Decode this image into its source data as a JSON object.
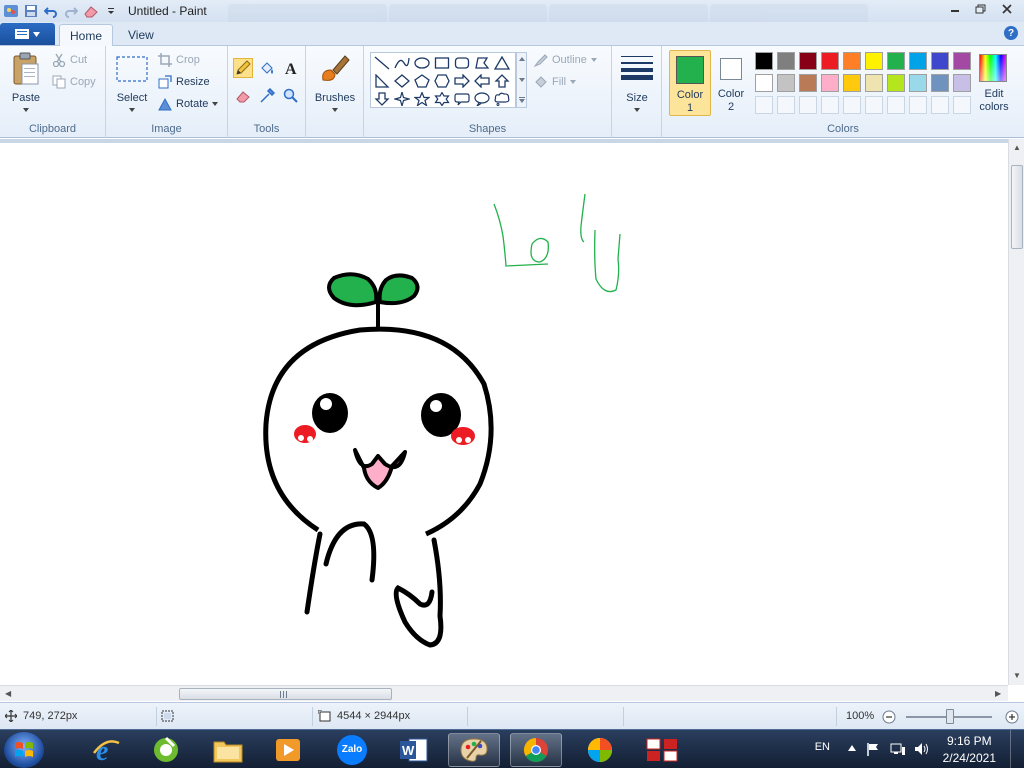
{
  "window": {
    "title": "Untitled - Paint"
  },
  "ribbon_tabs": {
    "home": "Home",
    "view": "View"
  },
  "clipboard": {
    "paste": "Paste",
    "cut": "Cut",
    "copy": "Copy",
    "label": "Clipboard"
  },
  "image": {
    "select": "Select",
    "crop": "Crop",
    "resize": "Resize",
    "rotate": "Rotate",
    "label": "Image"
  },
  "tools": {
    "label": "Tools",
    "active_tool": "pencil"
  },
  "brushes": {
    "label": "Brushes"
  },
  "shapes": {
    "outline": "Outline",
    "fill": "Fill",
    "label": "Shapes"
  },
  "size": {
    "label": "Size"
  },
  "colors": {
    "color1_line1": "Color",
    "color1_line2": "1",
    "color1_value": "#22b14c",
    "color2_line1": "Color",
    "color2_line2": "2",
    "color2_value": "#ffffff",
    "edit_line1": "Edit",
    "edit_line2": "colors",
    "label": "Colors",
    "palette_row1": [
      "#000000",
      "#7f7f7f",
      "#880015",
      "#ed1c24",
      "#ff7f27",
      "#fff200",
      "#22b14c",
      "#00a2e8",
      "#3f48cc",
      "#a349a4"
    ],
    "palette_row2": [
      "#ffffff",
      "#c3c3c3",
      "#b97a57",
      "#ffaec9",
      "#ffc90e",
      "#efe4b0",
      "#b5e61d",
      "#99d9ea",
      "#7092be",
      "#c8bfe7"
    ]
  },
  "status": {
    "cursor_pos": "749, 272px",
    "image_size": "4544 × 2944px",
    "zoom": "100%"
  },
  "taskbar": {
    "language": "EN",
    "time": "9:16 PM",
    "date": "2/24/2021",
    "zalo_label": "Zalo"
  }
}
